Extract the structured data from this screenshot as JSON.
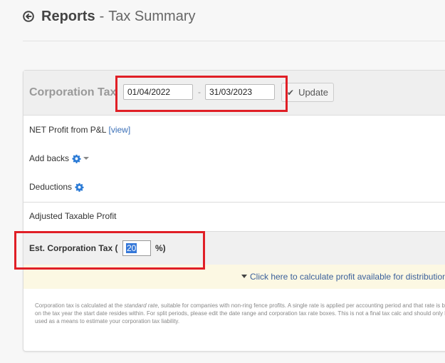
{
  "header": {
    "title": "Reports",
    "separator": "-",
    "subtitle": "Tax Summary"
  },
  "period": {
    "label": "Corporation Tax",
    "start_date": "01/04/2022",
    "dash": "-",
    "end_date": "31/03/2023",
    "update_label": "Update"
  },
  "rows": {
    "net_profit_label": "NET Profit from P&L",
    "view_link": "[view]",
    "add_backs_label": "Add backs",
    "deductions_label": "Deductions",
    "adjusted_label": "Adjusted Taxable Profit"
  },
  "tax": {
    "label": "Est. Corporation Tax (",
    "rate_value": "20",
    "suffix": "%)"
  },
  "calc_link": "Click here to calculate profit available for distribution",
  "note": {
    "part1": "Corporation tax is calculated at the ",
    "emphasis": "standard rate",
    "part2": ", suitable for companies with non-ring fence profits. A single rate is applied per accounting period and that rate is based on the tax year the start date resides within. For split periods, please edit the date range and corporation tax rate boxes. This is not a final tax calc and should only be used as a means to estimate your corporation tax liability."
  },
  "colors": {
    "highlight": "#e01f26",
    "link": "#3a6fb7",
    "gear": "#2b7bd6",
    "notice_bg": "#fcf8e3"
  }
}
